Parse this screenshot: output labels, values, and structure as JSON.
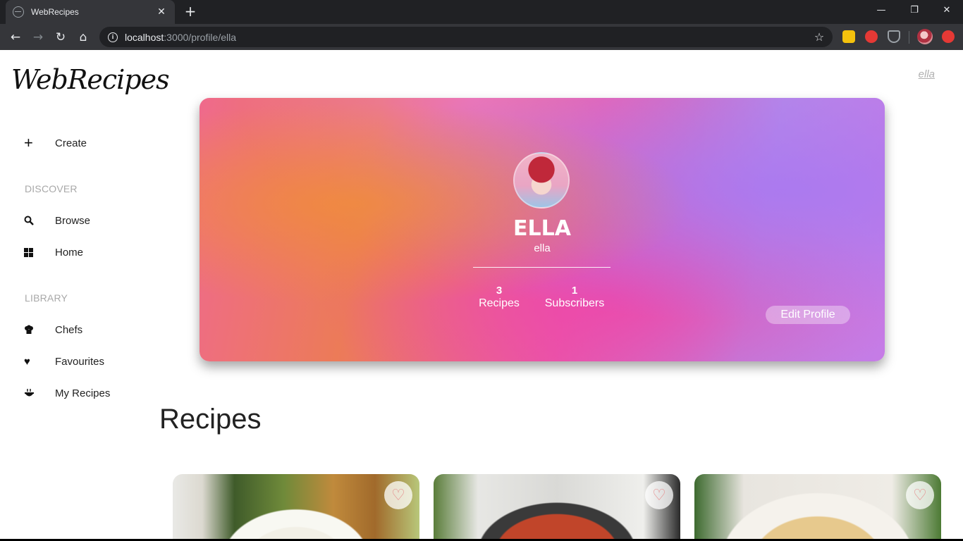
{
  "browser": {
    "tab_title": "WebRecipes",
    "tab_close": "✕",
    "new_tab": "+",
    "url_host": "localhost",
    "url_path": ":3000/profile/ella",
    "win_minimize": "—",
    "win_restore": "❐",
    "win_close": "✕"
  },
  "app": {
    "logo": "WebRecipes",
    "current_user": "ella"
  },
  "sidebar": {
    "create": {
      "label": "Create",
      "icon": "plus-icon"
    },
    "discover_heading": "DISCOVER",
    "discover": [
      {
        "label": "Browse",
        "icon": "search-icon"
      },
      {
        "label": "Home",
        "icon": "grid-icon"
      }
    ],
    "library_heading": "LIBRARY",
    "library": [
      {
        "label": "Chefs",
        "icon": "chef-hat-icon"
      },
      {
        "label": "Favourites",
        "icon": "heart-icon"
      },
      {
        "label": "My Recipes",
        "icon": "bowl-icon"
      }
    ]
  },
  "profile": {
    "name": "ELLA",
    "handle": "ella",
    "stats": [
      {
        "value": "3",
        "label": "Recipes"
      },
      {
        "value": "1",
        "label": "Subscribers"
      }
    ],
    "edit_label": "Edit Profile"
  },
  "recipes": {
    "title": "Recipes",
    "cards": [
      {
        "image": "chicken-soup-photo",
        "favourite": false
      },
      {
        "image": "shakshuka-photo",
        "favourite": false
      },
      {
        "image": "hummus-photo",
        "favourite": false
      }
    ]
  },
  "colors": {
    "browser_dark": "#202124",
    "toolbar": "#35363a",
    "muted_heading": "#a8a8a8",
    "heart": "#e58a8a"
  }
}
